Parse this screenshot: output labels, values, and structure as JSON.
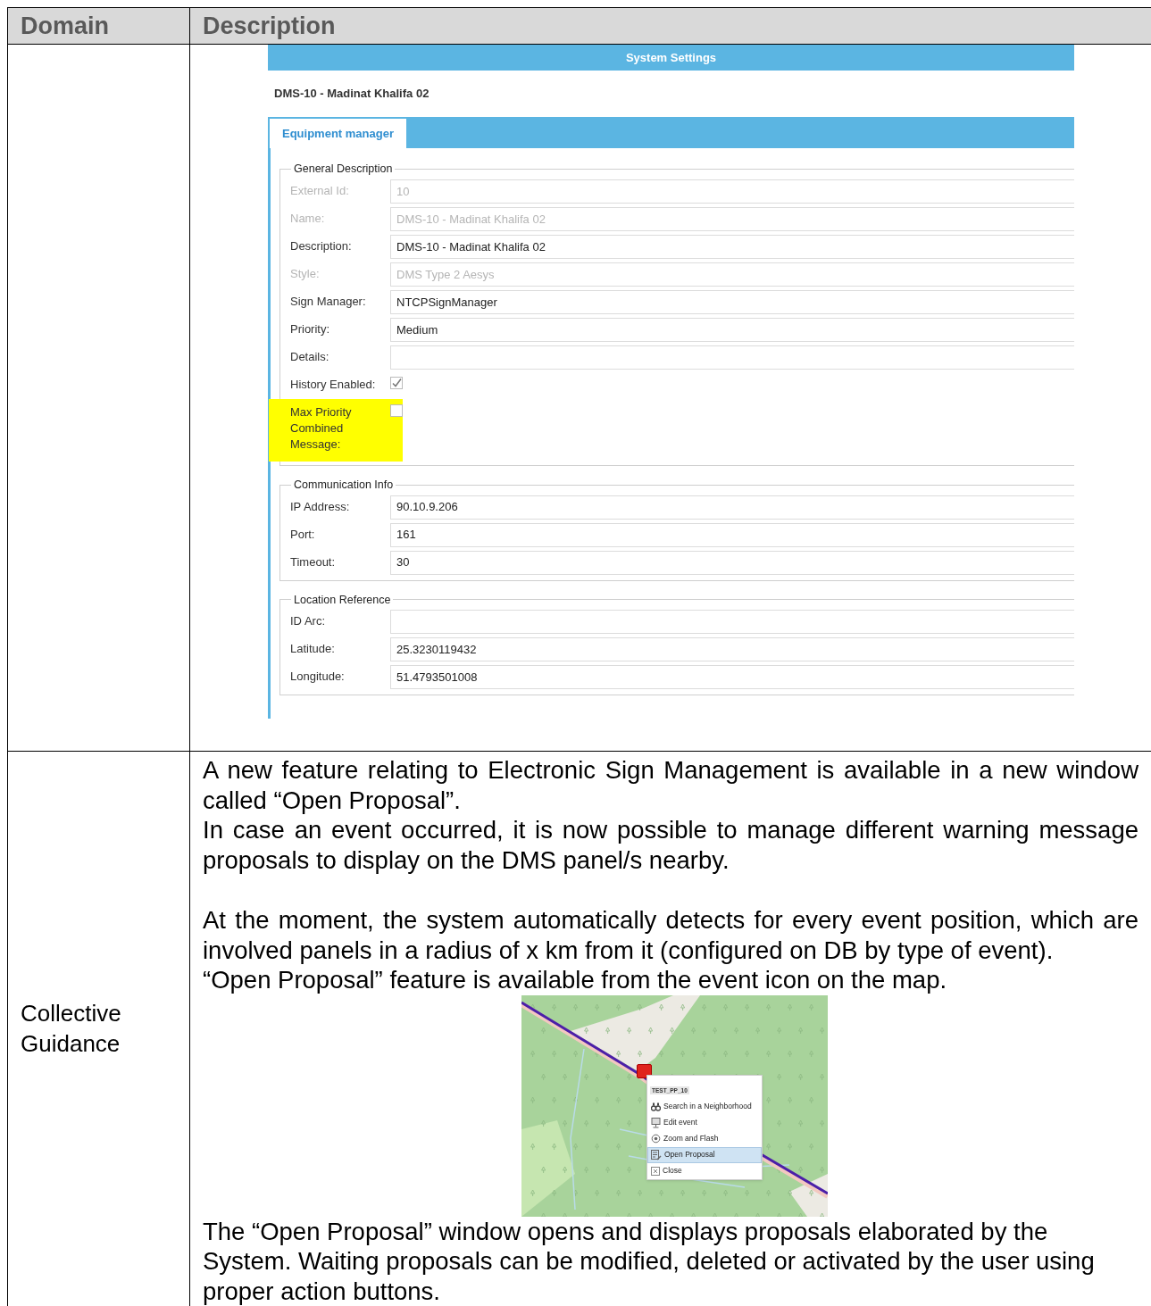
{
  "table": {
    "columns": [
      "Domain",
      "Description"
    ],
    "rows": [
      {
        "screenshot": {
          "window_title": "System Settings",
          "heading": "DMS-10 - Madinat Khalifa 02",
          "tabs": [
            {
              "label": "Equipment manager",
              "selected": true
            }
          ],
          "sections": [
            {
              "legend": "General Description",
              "fields": [
                {
                  "kind": "text",
                  "label": "External Id:",
                  "value": "10",
                  "disabled": true,
                  "highlighted": false
                },
                {
                  "kind": "text",
                  "label": "Name:",
                  "value": "DMS-10 - Madinat Khalifa 02",
                  "disabled": true,
                  "highlighted": false
                },
                {
                  "kind": "text",
                  "label": "Description:",
                  "value": "DMS-10 - Madinat Khalifa 02",
                  "disabled": false,
                  "highlighted": false
                },
                {
                  "kind": "text",
                  "label": "Style:",
                  "value": "DMS Type 2 Aesys",
                  "disabled": true,
                  "highlighted": false
                },
                {
                  "kind": "text",
                  "label": "Sign Manager:",
                  "value": "NTCPSignManager",
                  "disabled": false,
                  "highlighted": false
                },
                {
                  "kind": "text",
                  "label": "Priority:",
                  "value": "Medium",
                  "disabled": false,
                  "highlighted": false
                },
                {
                  "kind": "text",
                  "label": "Details:",
                  "disabled": false,
                  "highlighted": false
                },
                {
                  "kind": "checkbox",
                  "label": "History Enabled:",
                  "checked": true,
                  "highlighted": false
                },
                {
                  "kind": "checkbox",
                  "label": "Max Priority Combined Message:",
                  "checked": false,
                  "highlighted": true
                }
              ]
            },
            {
              "legend": "Communication Info",
              "fields": [
                {
                  "kind": "text",
                  "label": "IP Address:",
                  "value": "90.10.9.206",
                  "disabled": false,
                  "highlighted": false
                },
                {
                  "kind": "text",
                  "label": "Port:",
                  "value": "161",
                  "disabled": false,
                  "highlighted": false
                },
                {
                  "kind": "text",
                  "label": "Timeout:",
                  "value": "30",
                  "disabled": false,
                  "highlighted": false
                }
              ]
            },
            {
              "legend": "Location Reference",
              "fields": [
                {
                  "kind": "text",
                  "label": "ID Arc:",
                  "disabled": false,
                  "highlighted": false
                },
                {
                  "kind": "text",
                  "label": "Latitude:",
                  "value": "25.3230119432",
                  "disabled": false,
                  "highlighted": false
                },
                {
                  "kind": "text",
                  "label": "Longitude:",
                  "value": "51.4793501008",
                  "disabled": false,
                  "highlighted": false
                }
              ]
            }
          ]
        }
      },
      {
        "domain": "Collective Guidance",
        "blocks": [
          {
            "kind": "text",
            "spaced": false,
            "justified": true,
            "text": "A new feature relating to Electronic Sign Management is available in a new window called “Open Proposal”."
          },
          {
            "kind": "text",
            "spaced": false,
            "justified": true,
            "text": "In case an event occurred, it is now possible to manage different warning message proposals to display on the DMS panel/s nearby."
          },
          {
            "kind": "text",
            "spaced": true,
            "justified": true,
            "text": "At the moment, the system automatically detects for every event position, which are involved panels in a radius of x km from it (configured on DB by type of event)."
          },
          {
            "kind": "text",
            "text": "“Open Proposal” feature is available from the event icon on the map."
          },
          {
            "kind": "map",
            "menu_title": "TEST_PP_10",
            "menu": [
              {
                "label": "Search in a Neighborhood",
                "selected": false
              },
              {
                "label": "Edit event",
                "selected": false
              },
              {
                "label": "Zoom and Flash",
                "selected": false
              },
              {
                "label": "Open Proposal",
                "selected": true
              },
              {
                "label": "Close",
                "selected": false
              }
            ]
          },
          {
            "kind": "text",
            "spaced": false,
            "justified": false,
            "text": "The “Open Proposal” window opens and displays proposals elaborated by the System. Waiting proposals can be modified, deleted or activated by the user using proper action buttons."
          }
        ]
      }
    ]
  }
}
